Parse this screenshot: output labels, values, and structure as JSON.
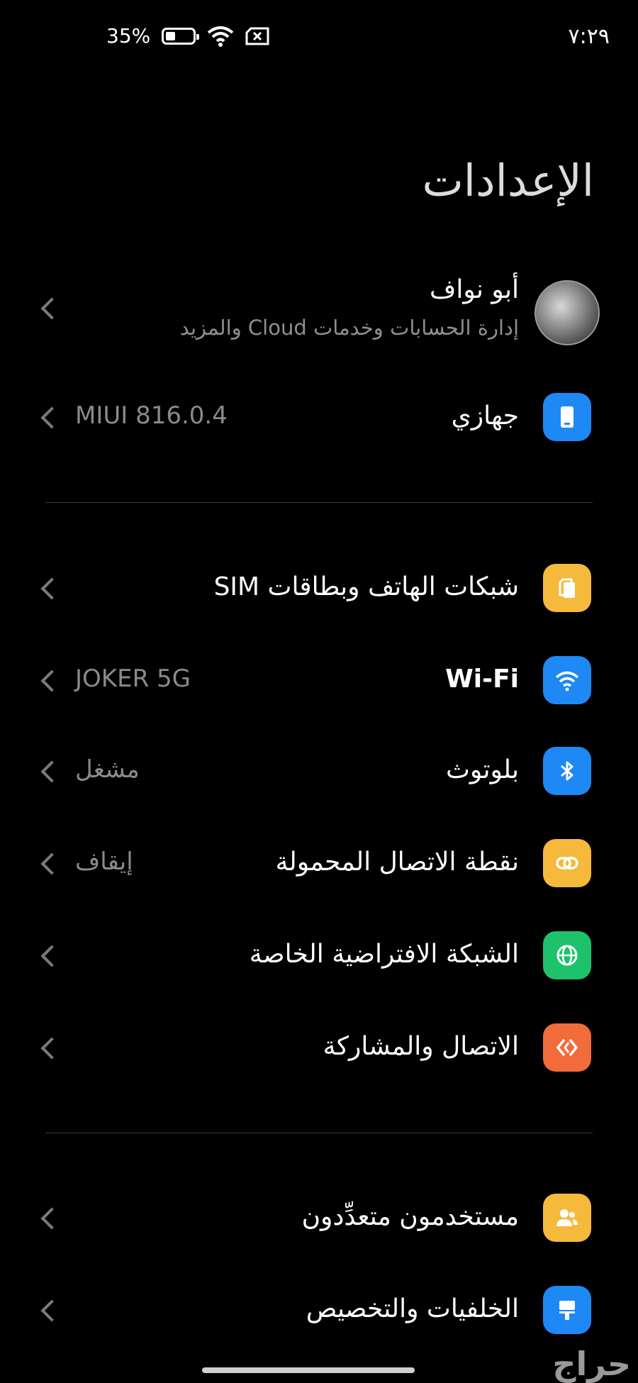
{
  "status_bar": {
    "time": "٧:٢٩",
    "battery": "35%",
    "battery_level": 0.35
  },
  "page_title": "الإعدادات",
  "profile": {
    "name": "أبو نواف",
    "subtitle": "إدارة الحسابات وخدمات Cloud والمزيد"
  },
  "device": {
    "label": "جهازي",
    "value": "MIUI 816.0.4",
    "icon": "phone-icon",
    "color": "#1e88f5"
  },
  "network_section": [
    {
      "label": "شبكات الهاتف وبطاقات SIM",
      "value": "",
      "icon": "sim-card-icon",
      "color": "#f5b93b"
    },
    {
      "label": "Wi-Fi",
      "value": "JOKER 5G",
      "icon": "wifi-icon",
      "color": "#1e88f5"
    },
    {
      "label": "بلوتوث",
      "value": "مشغل",
      "icon": "bluetooth-icon",
      "color": "#1e88f5"
    },
    {
      "label": "نقطة الاتصال المحمولة",
      "value": "إيقاف",
      "icon": "hotspot-icon",
      "color": "#f5b93b"
    },
    {
      "label": "الشبكة الافتراضية الخاصة",
      "value": "",
      "icon": "globe-icon",
      "color": "#1ec26b"
    },
    {
      "label": "الاتصال والمشاركة",
      "value": "",
      "icon": "share-icon",
      "color": "#f26b3a"
    }
  ],
  "personal_section": [
    {
      "label": "مستخدمون متعدِّدون",
      "value": "",
      "icon": "users-icon",
      "color": "#f5b93b"
    },
    {
      "label": "الخلفيات والتخصيص",
      "value": "",
      "icon": "brush-icon",
      "color": "#1e88f5"
    }
  ],
  "watermark": "حراج"
}
